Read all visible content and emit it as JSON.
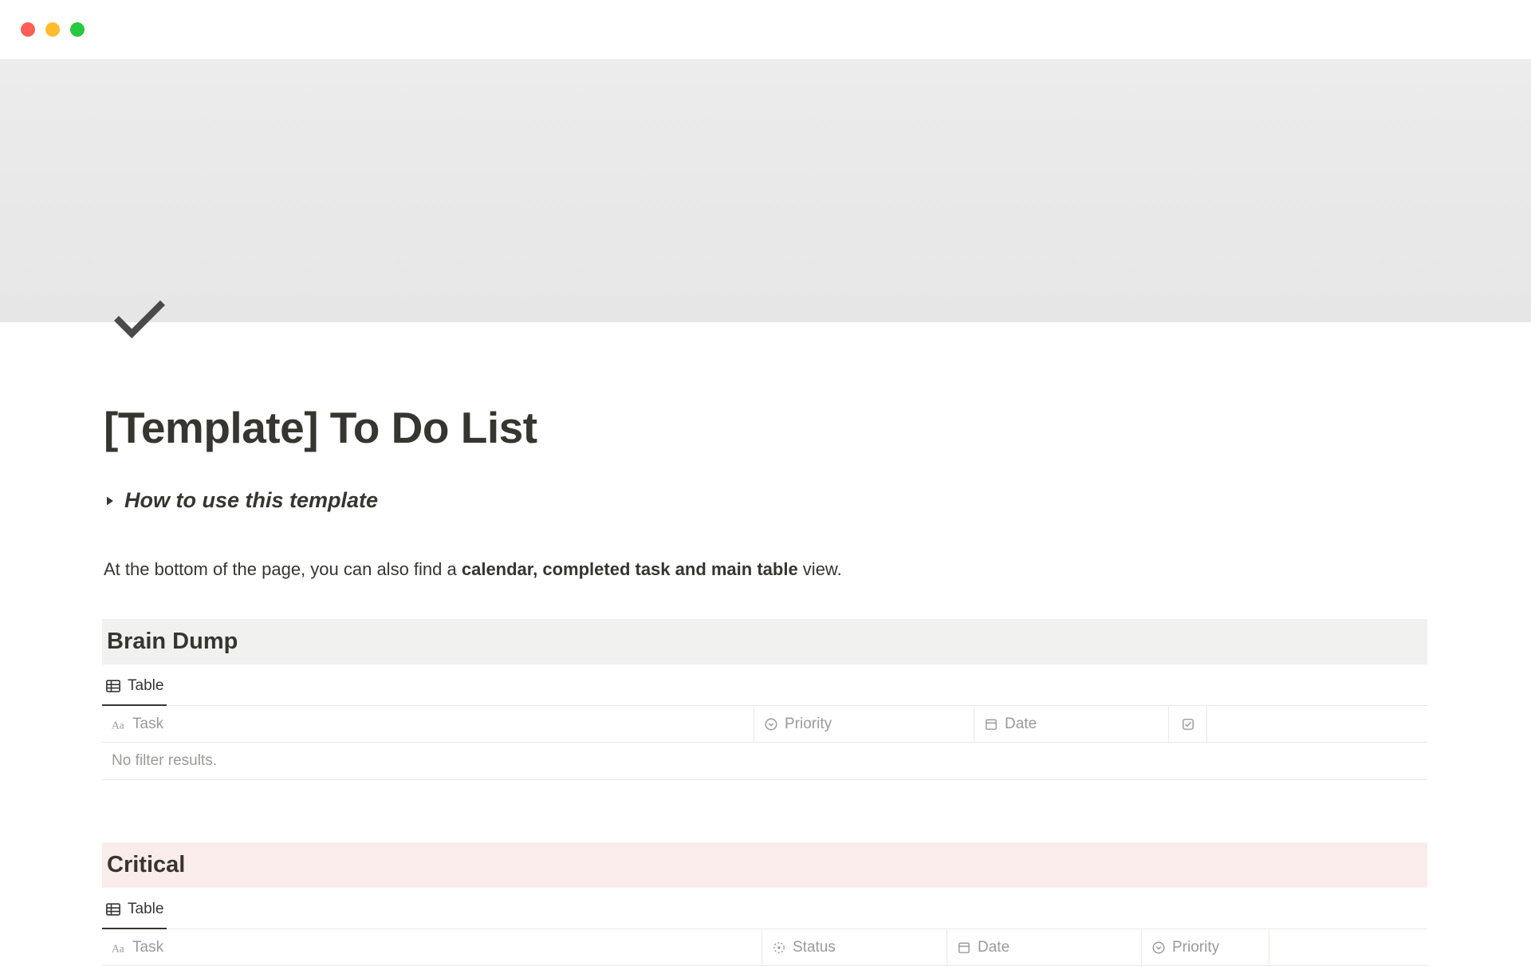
{
  "page": {
    "title": "[Template] To Do List",
    "toggleHeading": "How to use this template",
    "bodyTextPre": "At the bottom of the page, you can also find a ",
    "bodyTextBold": "calendar, completed task and main table",
    "bodyTextPost": " view."
  },
  "sections": {
    "brainDump": {
      "heading": "Brain Dump",
      "viewTab": "Table",
      "columns": {
        "task": "Task",
        "priority": "Priority",
        "date": "Date"
      },
      "emptyMessage": "No filter results."
    },
    "critical": {
      "heading": "Critical",
      "viewTab": "Table",
      "columns": {
        "task": "Task",
        "status": "Status",
        "date": "Date",
        "priority": "Priority"
      }
    }
  }
}
